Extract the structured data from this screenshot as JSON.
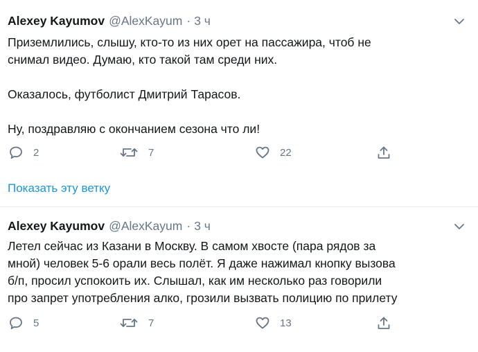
{
  "colors": {
    "accent": "#1b95e0",
    "secondary_text": "#657786",
    "text": "#14171a",
    "divider": "#e6ecf0"
  },
  "tweets": [
    {
      "author_name": "Alexey Kayumov",
      "handle": "@AlexKayum",
      "separator": "·",
      "time": "3 ч",
      "paragraphs": [
        "Приземлились, слышу, кто-то из них орет на пассажира, чтоб не\nснимал видео. Думаю, кто такой там среди них.",
        "Оказалось, футболист Дмитрий Тарасов.",
        "Ну, поздравляю с окончанием сезона что ли!"
      ],
      "reply_count": "2",
      "retweet_count": "7",
      "like_count": "22",
      "icons": {
        "reply": "reply-icon",
        "retweet": "retweet-icon",
        "like": "like-icon",
        "share": "share-icon",
        "menu": "chevron-down-icon"
      }
    },
    {
      "author_name": "Alexey Kayumov",
      "handle": "@AlexKayum",
      "separator": "·",
      "time": "3 ч",
      "paragraphs": [
        "Летел сейчас из Казани в Москву. В самом хвосте (пара рядов за\nмной) человек 5-6 орали весь полёт. Я даже нажимал кнопку вызова\nб/п, просил успокоить их. Слышал, как им несколько раз говорили\nпро запрет употребления алко, грозили вызвать полицию по прилету"
      ],
      "reply_count": "5",
      "retweet_count": "7",
      "like_count": "13",
      "icons": {
        "reply": "reply-icon",
        "retweet": "retweet-icon",
        "like": "like-icon",
        "share": "share-icon",
        "menu": "chevron-down-icon"
      }
    }
  ],
  "show_thread_label": "Показать эту ветку"
}
